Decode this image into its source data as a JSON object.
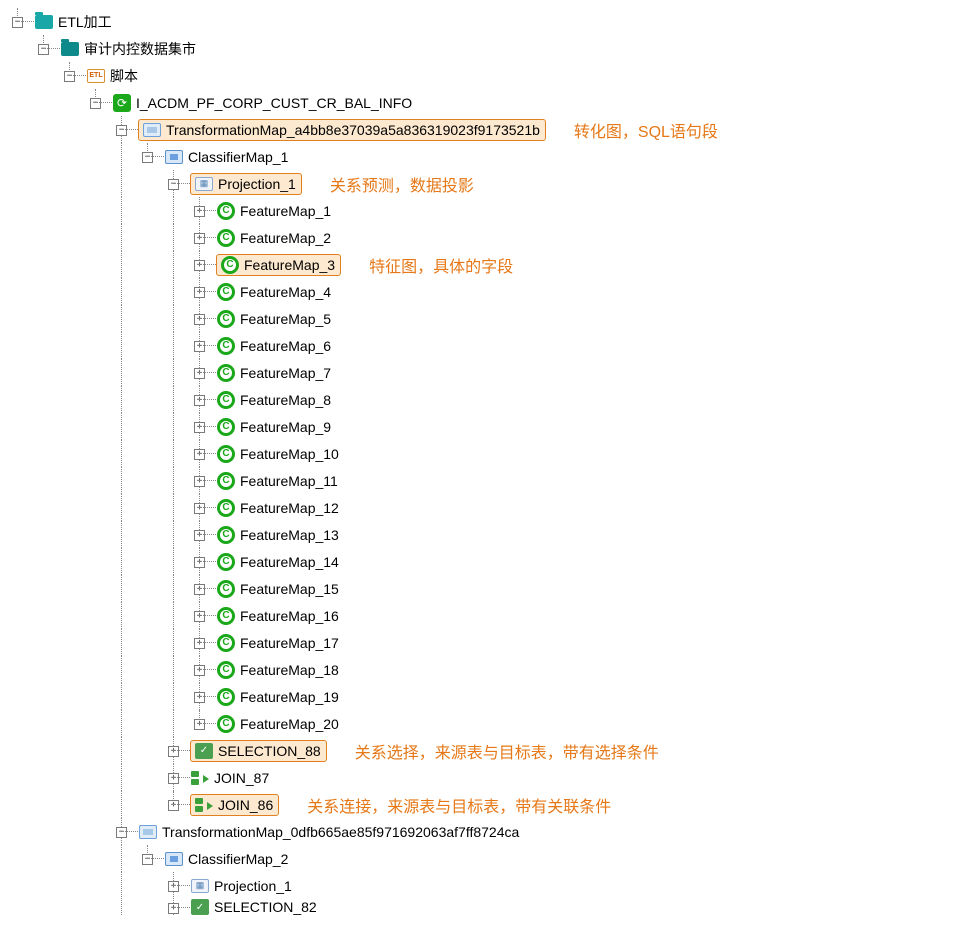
{
  "root": {
    "label": "ETL加工"
  },
  "mart": {
    "label": "审计内控数据集市"
  },
  "script": {
    "label": "脚本",
    "etl_badge": "ETL"
  },
  "job": {
    "label": "I_ACDM_PF_CORP_CUST_CR_BAL_INFO"
  },
  "tmap1": {
    "label": "TransformationMap_a4bb8e37039a5a836319023f9173521b",
    "annotation": "转化图，SQL语句段"
  },
  "cmap1": {
    "label": "ClassifierMap_1"
  },
  "proj1": {
    "label": "Projection_1",
    "annotation": "关系预测，数据投影"
  },
  "features": [
    "FeatureMap_1",
    "FeatureMap_2",
    "FeatureMap_3",
    "FeatureMap_4",
    "FeatureMap_5",
    "FeatureMap_6",
    "FeatureMap_7",
    "FeatureMap_8",
    "FeatureMap_9",
    "FeatureMap_10",
    "FeatureMap_11",
    "FeatureMap_12",
    "FeatureMap_13",
    "FeatureMap_14",
    "FeatureMap_15",
    "FeatureMap_16",
    "FeatureMap_17",
    "FeatureMap_18",
    "FeatureMap_19",
    "FeatureMap_20"
  ],
  "feature_annotation": "特征图，具体的字段",
  "sel88": {
    "label": "SELECTION_88",
    "annotation": "关系选择，来源表与目标表，带有选择条件"
  },
  "join87": {
    "label": "JOIN_87"
  },
  "join86": {
    "label": "JOIN_86",
    "annotation": "关系连接，来源表与目标表，带有关联条件"
  },
  "tmap2": {
    "label": "TransformationMap_0dfb665ae85f971692063af7ff8724ca"
  },
  "cmap2": {
    "label": "ClassifierMap_2"
  },
  "proj2": {
    "label": "Projection_1"
  },
  "sel82": {
    "label": "SELECTION_82"
  },
  "glyph": {
    "minus": "−",
    "plus": "+",
    "refresh": "⟳",
    "check": "✓",
    "c": "C"
  }
}
